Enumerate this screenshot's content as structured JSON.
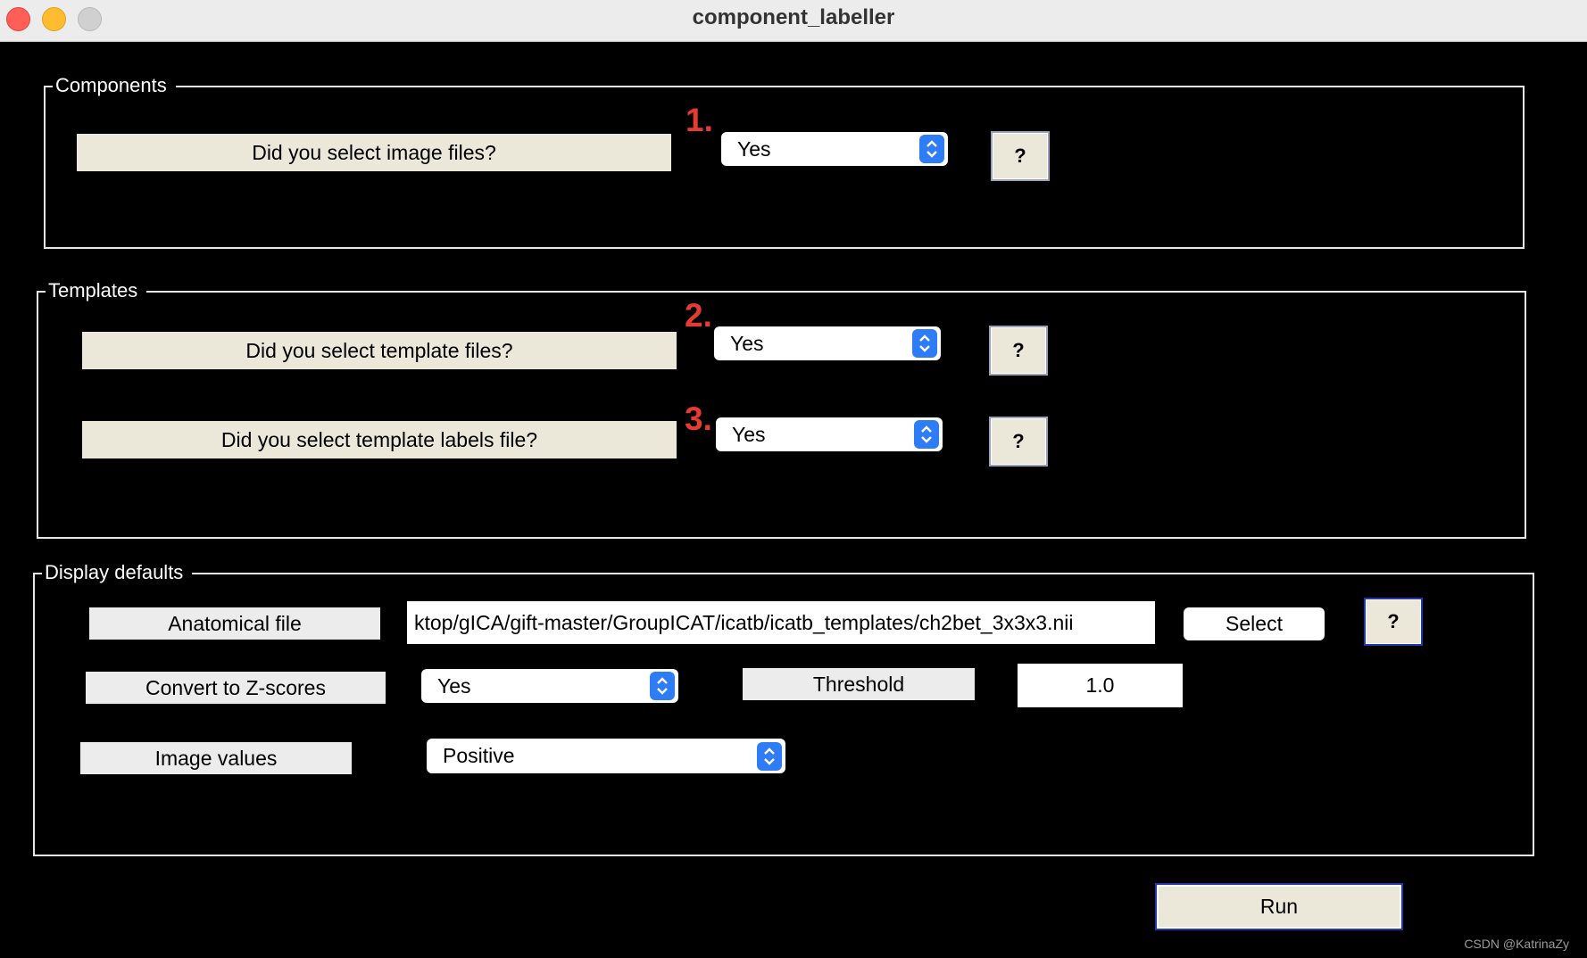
{
  "window": {
    "title": "component_labeller"
  },
  "components": {
    "legend": "Components",
    "step_number": "1.",
    "question": "Did you select image files?",
    "answer": "Yes",
    "help_label": "?"
  },
  "templates": {
    "legend": "Templates",
    "files": {
      "step_number": "2.",
      "question": "Did you select template files?",
      "answer": "Yes",
      "help_label": "?"
    },
    "labels": {
      "step_number": "3.",
      "question": "Did you select template labels file?",
      "answer": "Yes",
      "help_label": "?"
    }
  },
  "display_defaults": {
    "legend": "Display defaults",
    "anatomical": {
      "label": "Anatomical file",
      "path": "ktop/gICA/gift-master/GroupICAT/icatb/icatb_templates/ch2bet_3x3x3.nii",
      "select_label": "Select",
      "help_label": "?"
    },
    "zscores": {
      "label": "Convert to Z-scores",
      "value": "Yes"
    },
    "threshold": {
      "label": "Threshold",
      "value": "1.0"
    },
    "image_values": {
      "label": "Image values",
      "value": "Positive"
    }
  },
  "run_label": "Run",
  "watermark": "CSDN @KatrinaZy",
  "colors": {
    "background": "#000000",
    "button_face": "#ebe8da",
    "step_number": "#e53b32",
    "stepper_accent": "#2f7df6"
  }
}
